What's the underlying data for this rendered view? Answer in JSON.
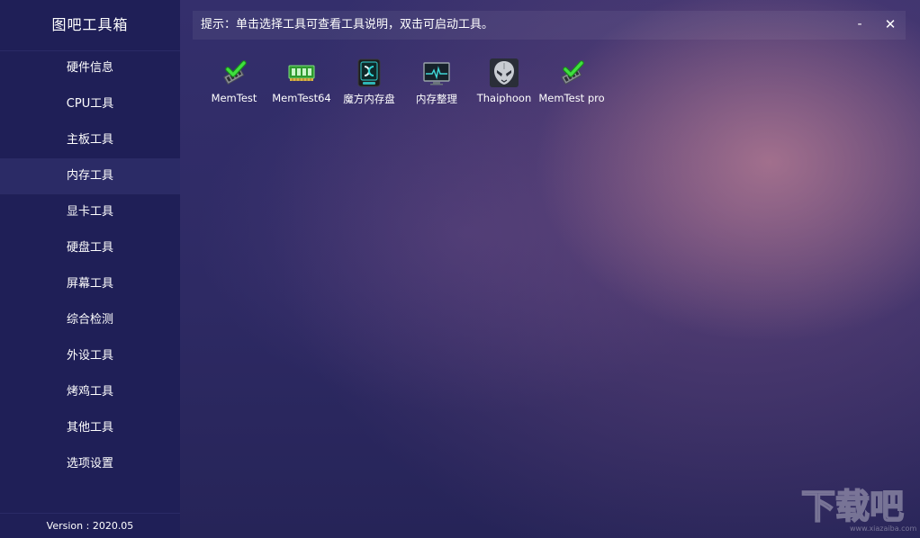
{
  "app": {
    "title": "图吧工具箱",
    "version": "Version : 2020.05"
  },
  "sidebar": {
    "items": [
      {
        "label": "硬件信息"
      },
      {
        "label": "CPU工具"
      },
      {
        "label": "主板工具"
      },
      {
        "label": "内存工具",
        "active": true
      },
      {
        "label": "显卡工具"
      },
      {
        "label": "硬盘工具"
      },
      {
        "label": "屏幕工具"
      },
      {
        "label": "综合检测"
      },
      {
        "label": "外设工具"
      },
      {
        "label": "烤鸡工具"
      },
      {
        "label": "其他工具"
      },
      {
        "label": "选项设置"
      }
    ]
  },
  "header": {
    "hint": "提示：单击选择工具可查看工具说明，双击可启动工具。",
    "minimize_label": "-",
    "close_label": "✕"
  },
  "tools": [
    {
      "label": "MemTest",
      "icon": "memtest-check-icon"
    },
    {
      "label": "MemTest64",
      "icon": "ram-module-icon"
    },
    {
      "label": "魔方内存盘",
      "icon": "ramdisk-icon"
    },
    {
      "label": "内存整理",
      "icon": "monitor-pulse-icon"
    },
    {
      "label": "Thaiphoon",
      "icon": "thaiphoon-alien-icon"
    },
    {
      "label": "MemTest pro",
      "icon": "memtest-check-icon"
    }
  ],
  "watermark": {
    "text": "下载吧",
    "url": "www.xiazaiba.com"
  }
}
